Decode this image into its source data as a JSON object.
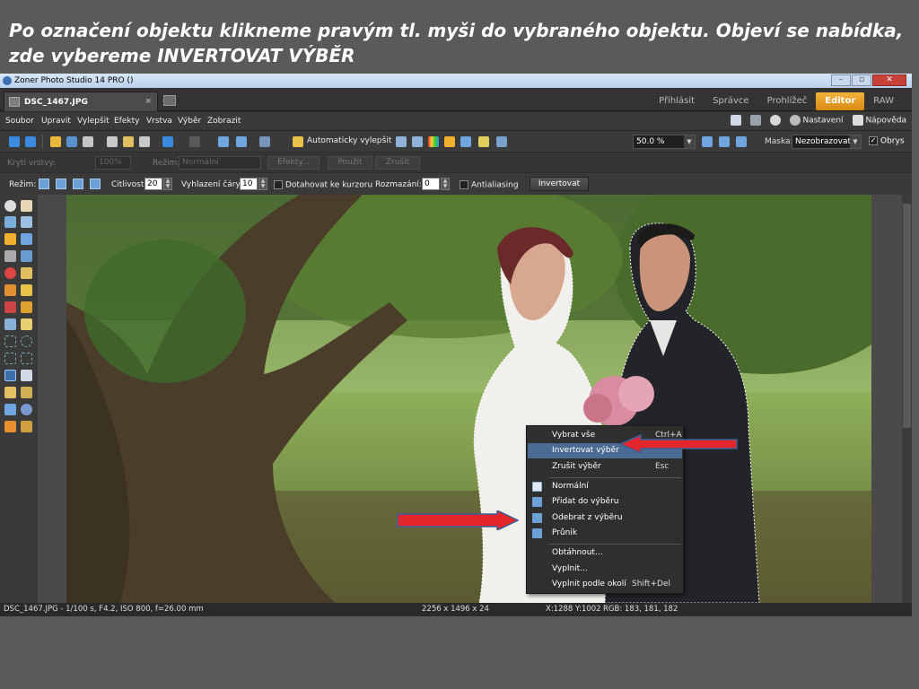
{
  "slide": {
    "title_line1": "Po označení objektu  klikneme pravým tl. myši do vybraného objektu. Objeví se nabídka,",
    "title_line2": "zde vybereme INVERTOVAT VÝBĚR"
  },
  "window": {
    "title": "Zoner Photo Studio 14 PRO  ()",
    "controls": [
      "–",
      "▫",
      "✕"
    ]
  },
  "tabs": {
    "doc_tab": "DSC_1467.JPG",
    "doc_close": "×",
    "modes": [
      "Přihlásit",
      "Správce",
      "Prohlížeč",
      "Editor",
      "RAW"
    ],
    "active_mode": "Editor"
  },
  "menu": {
    "items": [
      "Soubor",
      "Upravit",
      "Vylepšit",
      "Efekty",
      "Vrstva",
      "Výběr",
      "Zobrazit"
    ],
    "settings": "Nastavení",
    "help": "Nápověda"
  },
  "toolbar": {
    "auto_enhance": "Automaticky vylepšit",
    "zoom": "50.0 %",
    "mask_label": "Maska:",
    "mask_value": "Nezobrazovat",
    "outline": "Obrys"
  },
  "layerbar": {
    "opacity_label": "Krytí vrstvy:",
    "opacity_value": "100%",
    "mode_label": "Režim:",
    "mode_value": "Normální",
    "effects": "Efekty...",
    "apply": "Použít",
    "cancel": "Zrušit"
  },
  "options": {
    "mode_label": "Režim:",
    "sensitivity_label": "Citlivost:",
    "sensitivity_value": "20",
    "smoothing_label": "Vyhlazení čáry:",
    "smoothing_value": "10",
    "snap_label": "Dotahovat ke kurzoru",
    "blur_label": "Rozmazání:",
    "blur_value": "0",
    "antialias_label": "Antialiasing",
    "invert_button": "Invertovat"
  },
  "status": {
    "file_info": "DSC_1467.JPG - 1/100 s, F4.2, ISO 800, f=26.00 mm",
    "dimensions": "2256 x 1496 x 24",
    "position": "X:1288 Y:1002",
    "rgb": "RGB: 183, 181, 182"
  },
  "context_menu": {
    "select_all": "Vybrat vše",
    "select_all_shortcut": "Ctrl+A",
    "invert": "Invertovat výběr",
    "deselect": "Zrušit výběr",
    "deselect_shortcut": "Esc",
    "normal": "Normální",
    "add": "Přidat do výběru",
    "subtract": "Odebrat z výběru",
    "intersect": "Průnik",
    "outline": "Obtáhnout...",
    "fill": "Vyplnit...",
    "fill_surround": "Vyplnit podle okolí",
    "fill_surround_shortcut": "Shift+Del"
  },
  "colors": {
    "accent_tab": "#e89a1c",
    "highlight": "#4b6b92",
    "arrow_red": "#e2262b",
    "arrow_blue_border": "#3a5f9a"
  },
  "icons": [
    "search-icon",
    "hand-icon",
    "undo-icon",
    "redo-icon",
    "save-icon",
    "print-icon",
    "gear-icon",
    "help-icon",
    "arrow-icon"
  ]
}
